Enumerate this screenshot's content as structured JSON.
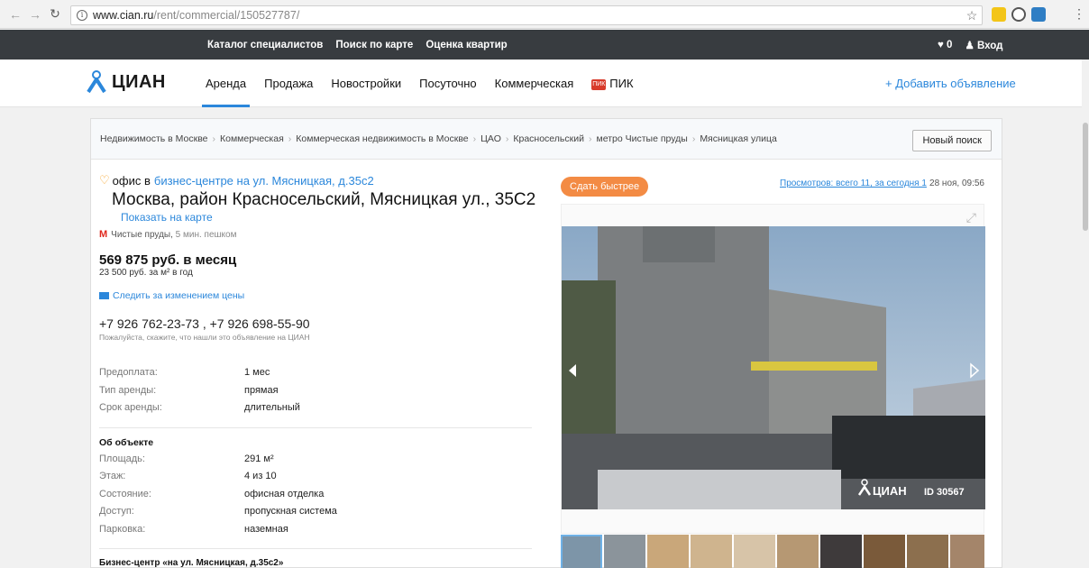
{
  "browser": {
    "url_host": "www.cian.ru",
    "url_path": "/rent/commercial/150527787/"
  },
  "topbar": {
    "links": [
      "Каталог специалистов",
      "Поиск по карте",
      "Оценка квартир"
    ],
    "favorites_count": "0",
    "login": "Вход"
  },
  "nav": {
    "logo": "ЦИАН",
    "items": [
      "Аренда",
      "Продажа",
      "Новостройки",
      "Посуточно",
      "Коммерческая"
    ],
    "pik": "ПИК",
    "add_ad": "+ Добавить объявление"
  },
  "breadcrumbs": [
    "Недвижимость в Москве",
    "Коммерческая",
    "Коммерческая недвижимость в Москве",
    "ЦАО",
    "Красносельский",
    "метро Чистые пруды",
    "Мясницкая улица"
  ],
  "new_search": "Новый поиск",
  "listing": {
    "type_prefix": "офис в",
    "type_link": "бизнес-центре на ул. Мясницкая, д.35с2",
    "address": "Москва, район Красносельский, Мясницкая ул., 35С2",
    "map_link": "Показать на карте",
    "metro_station": "Чистые пруды,",
    "metro_walk": "5 мин. пешком",
    "price": "569 875 руб. в месяц",
    "price_per_m": "23 500 руб. за м² в год",
    "follow_price": "Следить за изменением цены",
    "phones": "+7 926 762-23-73 , +7 926 698-55-90",
    "phone_hint": "Пожалуйста, скажите, что нашли это объявление на ЦИАН",
    "terms": [
      {
        "k": "Предоплата:",
        "v": "1 мес"
      },
      {
        "k": "Тип аренды:",
        "v": "прямая"
      },
      {
        "k": "Срок аренды:",
        "v": "длительный"
      }
    ],
    "about_title": "Об объекте",
    "about": [
      {
        "k": "Площадь:",
        "v": "291 м²"
      },
      {
        "k": "Этаж:",
        "v": "4 из 10"
      },
      {
        "k": "Состояние:",
        "v": "офисная отделка"
      },
      {
        "k": "Доступ:",
        "v": "пропускная система"
      },
      {
        "k": "Парковка:",
        "v": "наземная"
      }
    ],
    "bc_title": "Бизнес-центр «на ул. Мясницкая, д.35с2»"
  },
  "gallery": {
    "sell_faster": "Сдать быстрее",
    "views": "Просмотров: всего 11, за сегодня 1",
    "date": "28 ноя, 09:56",
    "watermark_logo": "ЦИАН",
    "watermark_id": "ID 30567",
    "thumb_colors": [
      "#7d95a8",
      "#8b949b",
      "#c9a77a",
      "#cfb48e",
      "#d7c4a8",
      "#b69873",
      "#3e3a3b",
      "#7a5a3a",
      "#8c6f4e",
      "#a4856a"
    ]
  }
}
